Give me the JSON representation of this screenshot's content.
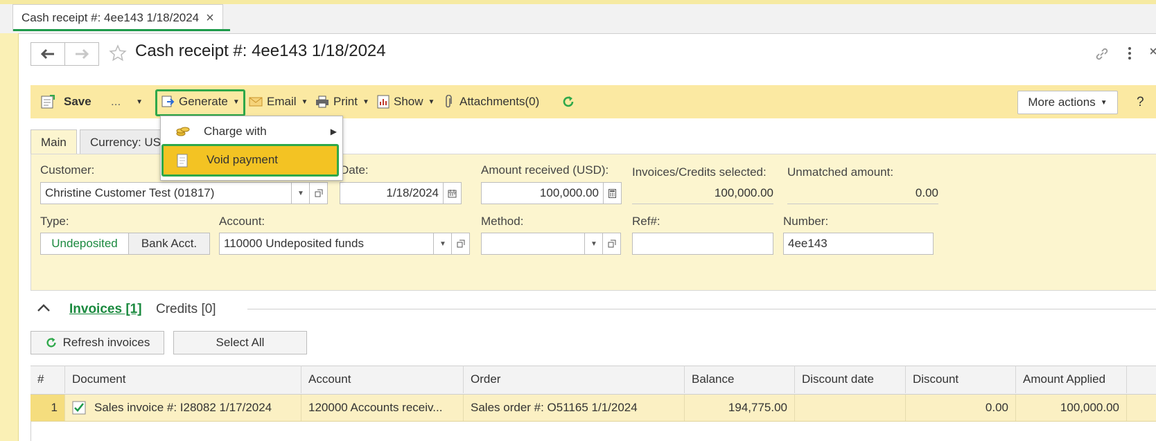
{
  "window_tab": {
    "label": "Cash receipt #: 4ee143 1/18/2024",
    "close": "×"
  },
  "header": {
    "title": "Cash receipt #: 4ee143 1/18/2024"
  },
  "toolbar": {
    "save_label": "Save",
    "ellipsis_label": "...",
    "generate_label": "Generate",
    "email_label": "Email",
    "print_label": "Print",
    "show_label": "Show",
    "attachments_label": "Attachments(0)",
    "more_actions_label": "More actions",
    "help_label": "?"
  },
  "generate_menu": {
    "items": [
      {
        "label": "Charge with",
        "has_submenu": true
      },
      {
        "label": "Void payment",
        "highlighted": true
      }
    ]
  },
  "form_tabs": [
    {
      "label": "Main",
      "active": true
    },
    {
      "label": "Currency: US"
    }
  ],
  "form": {
    "customer_label": "Customer:",
    "customer_value": "Christine Customer Test (01817)",
    "date_label": "Date:",
    "date_value": "1/18/2024",
    "amount_label": "Amount received (USD):",
    "amount_value": "100,000.00",
    "selected_label": "Invoices/Credits selected:",
    "selected_value": "100,000.00",
    "unmatched_label": "Unmatched amount:",
    "unmatched_value": "0.00",
    "type_label": "Type:",
    "type_options": [
      "Undeposited",
      "Bank Acct."
    ],
    "type_selected": "Undeposited",
    "account_label": "Account:",
    "account_value": "110000 Undeposited funds",
    "method_label": "Method:",
    "method_value": "",
    "ref_label": "Ref#:",
    "ref_value": "",
    "number_label": "Number:",
    "number_value": "4ee143"
  },
  "invoices_section": {
    "invoices_tab": "Invoices [1]",
    "credits_tab": "Credits [0]",
    "refresh_label": "Refresh invoices",
    "select_all_label": "Select All"
  },
  "grid": {
    "columns": [
      "#",
      "Document",
      "Account",
      "Order",
      "Balance",
      "Discount date",
      "Discount",
      "Amount Applied"
    ],
    "rows": [
      {
        "num": "1",
        "checked": true,
        "document": "Sales invoice #: I28082 1/17/2024",
        "account": "120000 Accounts receiv...",
        "order": "Sales order #: O51165 1/1/2024",
        "balance": "194,775.00",
        "discount_date": "",
        "discount": "0.00",
        "amount_applied": "100,000.00"
      }
    ]
  },
  "colors": {
    "accent_green": "#2ea84a",
    "toolbar_yellow": "#fbe9a2",
    "highlight_yellow": "#f3c323",
    "link_green": "#1b8a3f"
  }
}
